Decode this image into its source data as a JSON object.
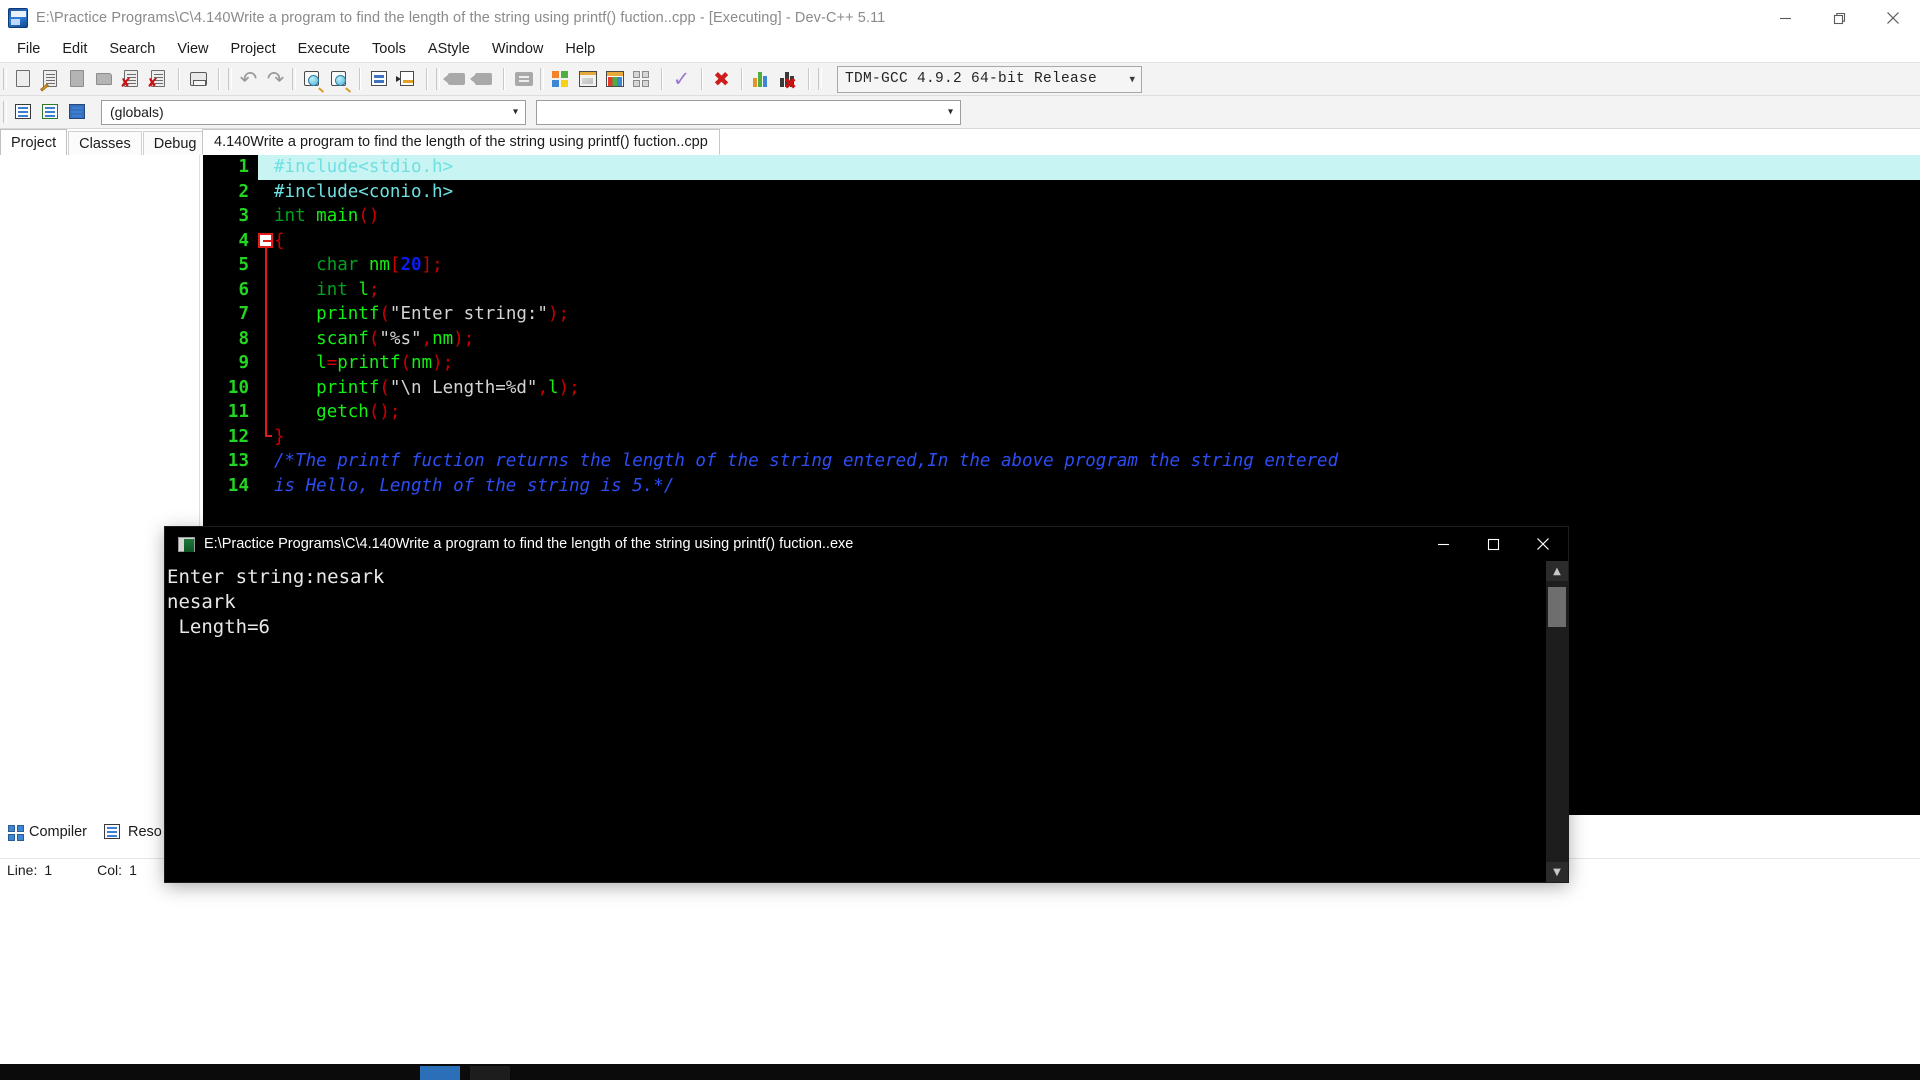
{
  "window": {
    "title": "E:\\Practice Programs\\C\\4.140Write a program to find the length of the string using printf() fuction..cpp - [Executing] - Dev-C++ 5.11",
    "app_icon": "devcpp-icon",
    "minimize_label": "—",
    "restore_label": "❐",
    "close_label": "✕"
  },
  "menu": {
    "items": [
      "File",
      "Edit",
      "Search",
      "View",
      "Project",
      "Execute",
      "Tools",
      "AStyle",
      "Window",
      "Help"
    ]
  },
  "toolbar": {
    "compiler_set": "TDM-GCC 4.9.2 64-bit Release",
    "chevron": "▾",
    "buttons": [
      {
        "name": "new-file-button",
        "icon": "new-file-icon"
      },
      {
        "name": "open-file-button",
        "icon": "open-file-icon"
      },
      {
        "name": "save-button",
        "icon": "save-icon"
      },
      {
        "name": "save-all-button",
        "icon": "save-all-icon"
      },
      {
        "name": "close-file-button",
        "icon": "close-file-icon"
      },
      {
        "name": "close-all-button",
        "icon": "close-all-icon"
      },
      {
        "name": "print-button",
        "icon": "printer-icon"
      },
      {
        "name": "undo-button",
        "icon": "undo-arrow-icon"
      },
      {
        "name": "redo-button",
        "icon": "redo-arrow-icon"
      },
      {
        "name": "find-button",
        "icon": "magnifier-icon"
      },
      {
        "name": "replace-button",
        "icon": "magnifier-replace-icon"
      },
      {
        "name": "find-next-button",
        "icon": "list-icon"
      },
      {
        "name": "goto-line-button",
        "icon": "goto-line-icon"
      },
      {
        "name": "back-button",
        "icon": "tag-left-icon"
      },
      {
        "name": "forward-button",
        "icon": "tag-right-icon"
      },
      {
        "name": "toggle-bookmark-button",
        "icon": "equals-box-icon"
      },
      {
        "name": "compile-button",
        "icon": "color-quad-icon"
      },
      {
        "name": "run-button",
        "icon": "window-icon"
      },
      {
        "name": "compile-and-run-button",
        "icon": "color-window-icon"
      },
      {
        "name": "rebuild-all-button",
        "icon": "gray-quad-icon"
      },
      {
        "name": "syntax-check-button",
        "icon": "check-icon"
      },
      {
        "name": "stop-execution-button",
        "icon": "red-x-icon"
      },
      {
        "name": "profile-button",
        "icon": "bar-chart-icon"
      },
      {
        "name": "delete-profile-button",
        "icon": "bar-chart-delete-icon"
      }
    ]
  },
  "toolbar2": {
    "buttons": [
      {
        "name": "new-class-button",
        "icon": "class-icon"
      },
      {
        "name": "new-member-button",
        "icon": "member-icon"
      },
      {
        "name": "browse-button",
        "icon": "browse-icon"
      }
    ],
    "scope_value": "(globals)",
    "symbol_value": "",
    "chevron": "▾"
  },
  "left_panel": {
    "tabs": [
      {
        "label": "Project",
        "active": true
      },
      {
        "label": "Classes",
        "active": false
      },
      {
        "label": "Debug",
        "active": false
      }
    ]
  },
  "editor": {
    "tab_label": "4.140Write a program to find the length of the string using printf() fuction..cpp",
    "lines": [
      {
        "n": "1",
        "fold": "none",
        "highlight": true,
        "tokens": [
          {
            "t": "#include<stdio.h>",
            "c": "pre"
          }
        ]
      },
      {
        "n": "2",
        "fold": "none",
        "highlight": false,
        "tokens": [
          {
            "t": "#include<conio.h>",
            "c": "pre"
          }
        ]
      },
      {
        "n": "3",
        "fold": "none",
        "highlight": false,
        "tokens": [
          {
            "t": "int ",
            "c": "k"
          },
          {
            "t": "main",
            "c": "id"
          },
          {
            "t": "()",
            "c": "p"
          }
        ]
      },
      {
        "n": "4",
        "fold": "minus",
        "highlight": false,
        "tokens": [
          {
            "t": "{",
            "c": "brc"
          }
        ]
      },
      {
        "n": "5",
        "fold": "line",
        "highlight": false,
        "tokens": [
          {
            "t": "    ",
            "c": "str"
          },
          {
            "t": "char ",
            "c": "k"
          },
          {
            "t": "nm",
            "c": "id"
          },
          {
            "t": "[",
            "c": "p"
          },
          {
            "t": "20",
            "c": "num"
          },
          {
            "t": "]",
            "c": "p"
          },
          {
            "t": ";",
            "c": "p"
          }
        ]
      },
      {
        "n": "6",
        "fold": "line",
        "highlight": false,
        "tokens": [
          {
            "t": "    ",
            "c": "str"
          },
          {
            "t": "int ",
            "c": "k"
          },
          {
            "t": "l",
            "c": "id"
          },
          {
            "t": ";",
            "c": "p"
          }
        ]
      },
      {
        "n": "7",
        "fold": "line",
        "highlight": false,
        "tokens": [
          {
            "t": "    ",
            "c": "str"
          },
          {
            "t": "printf",
            "c": "id"
          },
          {
            "t": "(",
            "c": "p"
          },
          {
            "t": "\"Enter string:\"",
            "c": "str"
          },
          {
            "t": ");",
            "c": "p"
          }
        ]
      },
      {
        "n": "8",
        "fold": "line",
        "highlight": false,
        "tokens": [
          {
            "t": "    ",
            "c": "str"
          },
          {
            "t": "scanf",
            "c": "id"
          },
          {
            "t": "(",
            "c": "p"
          },
          {
            "t": "\"%s\"",
            "c": "str"
          },
          {
            "t": ",",
            "c": "p"
          },
          {
            "t": "nm",
            "c": "id"
          },
          {
            "t": ");",
            "c": "p"
          }
        ]
      },
      {
        "n": "9",
        "fold": "line",
        "highlight": false,
        "tokens": [
          {
            "t": "    ",
            "c": "str"
          },
          {
            "t": "l",
            "c": "id"
          },
          {
            "t": "=",
            "c": "p"
          },
          {
            "t": "printf",
            "c": "id"
          },
          {
            "t": "(",
            "c": "p"
          },
          {
            "t": "nm",
            "c": "id"
          },
          {
            "t": ");",
            "c": "p"
          }
        ]
      },
      {
        "n": "10",
        "fold": "line",
        "highlight": false,
        "tokens": [
          {
            "t": "    ",
            "c": "str"
          },
          {
            "t": "printf",
            "c": "id"
          },
          {
            "t": "(",
            "c": "p"
          },
          {
            "t": "\"\\n Length=%d\"",
            "c": "str"
          },
          {
            "t": ",",
            "c": "p"
          },
          {
            "t": "l",
            "c": "id"
          },
          {
            "t": ");",
            "c": "p"
          }
        ]
      },
      {
        "n": "11",
        "fold": "line",
        "highlight": false,
        "tokens": [
          {
            "t": "    ",
            "c": "str"
          },
          {
            "t": "getch",
            "c": "id"
          },
          {
            "t": "();",
            "c": "p"
          }
        ]
      },
      {
        "n": "12",
        "fold": "end",
        "highlight": false,
        "tokens": [
          {
            "t": "}",
            "c": "brc"
          }
        ]
      },
      {
        "n": "13",
        "fold": "none",
        "highlight": false,
        "tokens": [
          {
            "t": "/*The printf fuction returns the length of the string entered,In the above program the string entered",
            "c": "cm"
          }
        ]
      },
      {
        "n": "14",
        "fold": "none",
        "highlight": false,
        "tokens": [
          {
            "t": "is Hello, Length of the string is 5.*/",
            "c": "cm"
          }
        ]
      }
    ]
  },
  "bottom_panel": {
    "tabs": [
      {
        "label": "Compiler",
        "icon": "compiler-icon"
      },
      {
        "label": "Reso",
        "icon": "resource-icon"
      }
    ]
  },
  "statusbar": {
    "line_label": "Line:",
    "line_value": "1",
    "col_label": "Col:",
    "col_value": "1"
  },
  "console": {
    "title": "E:\\Practice Programs\\C\\4.140Write a program to find the length of the string using printf() fuction..exe",
    "icon": "console-app-icon",
    "minimize_label": "—",
    "maximize_label": "☐",
    "close_label": "✕",
    "output": [
      "Enter string:nesark",
      "nesark",
      " Length=6"
    ],
    "scroll_up": "▲",
    "scroll_down": "▼"
  },
  "colors": {
    "editor_bg": "#000000",
    "line_number": "#22d622",
    "current_line_highlight": "#c9f4f4",
    "preprocessor": "#6fe0e0",
    "keyword": "#00a31e",
    "identifier": "#13f013",
    "number": "#0a1ef0",
    "punctuation": "#cc0000",
    "string": "#d4d4d4",
    "comment": "#2d4df5",
    "fold_marker": "#e01b1b",
    "console_bg": "#000000",
    "console_text": "#e8e8e8"
  }
}
